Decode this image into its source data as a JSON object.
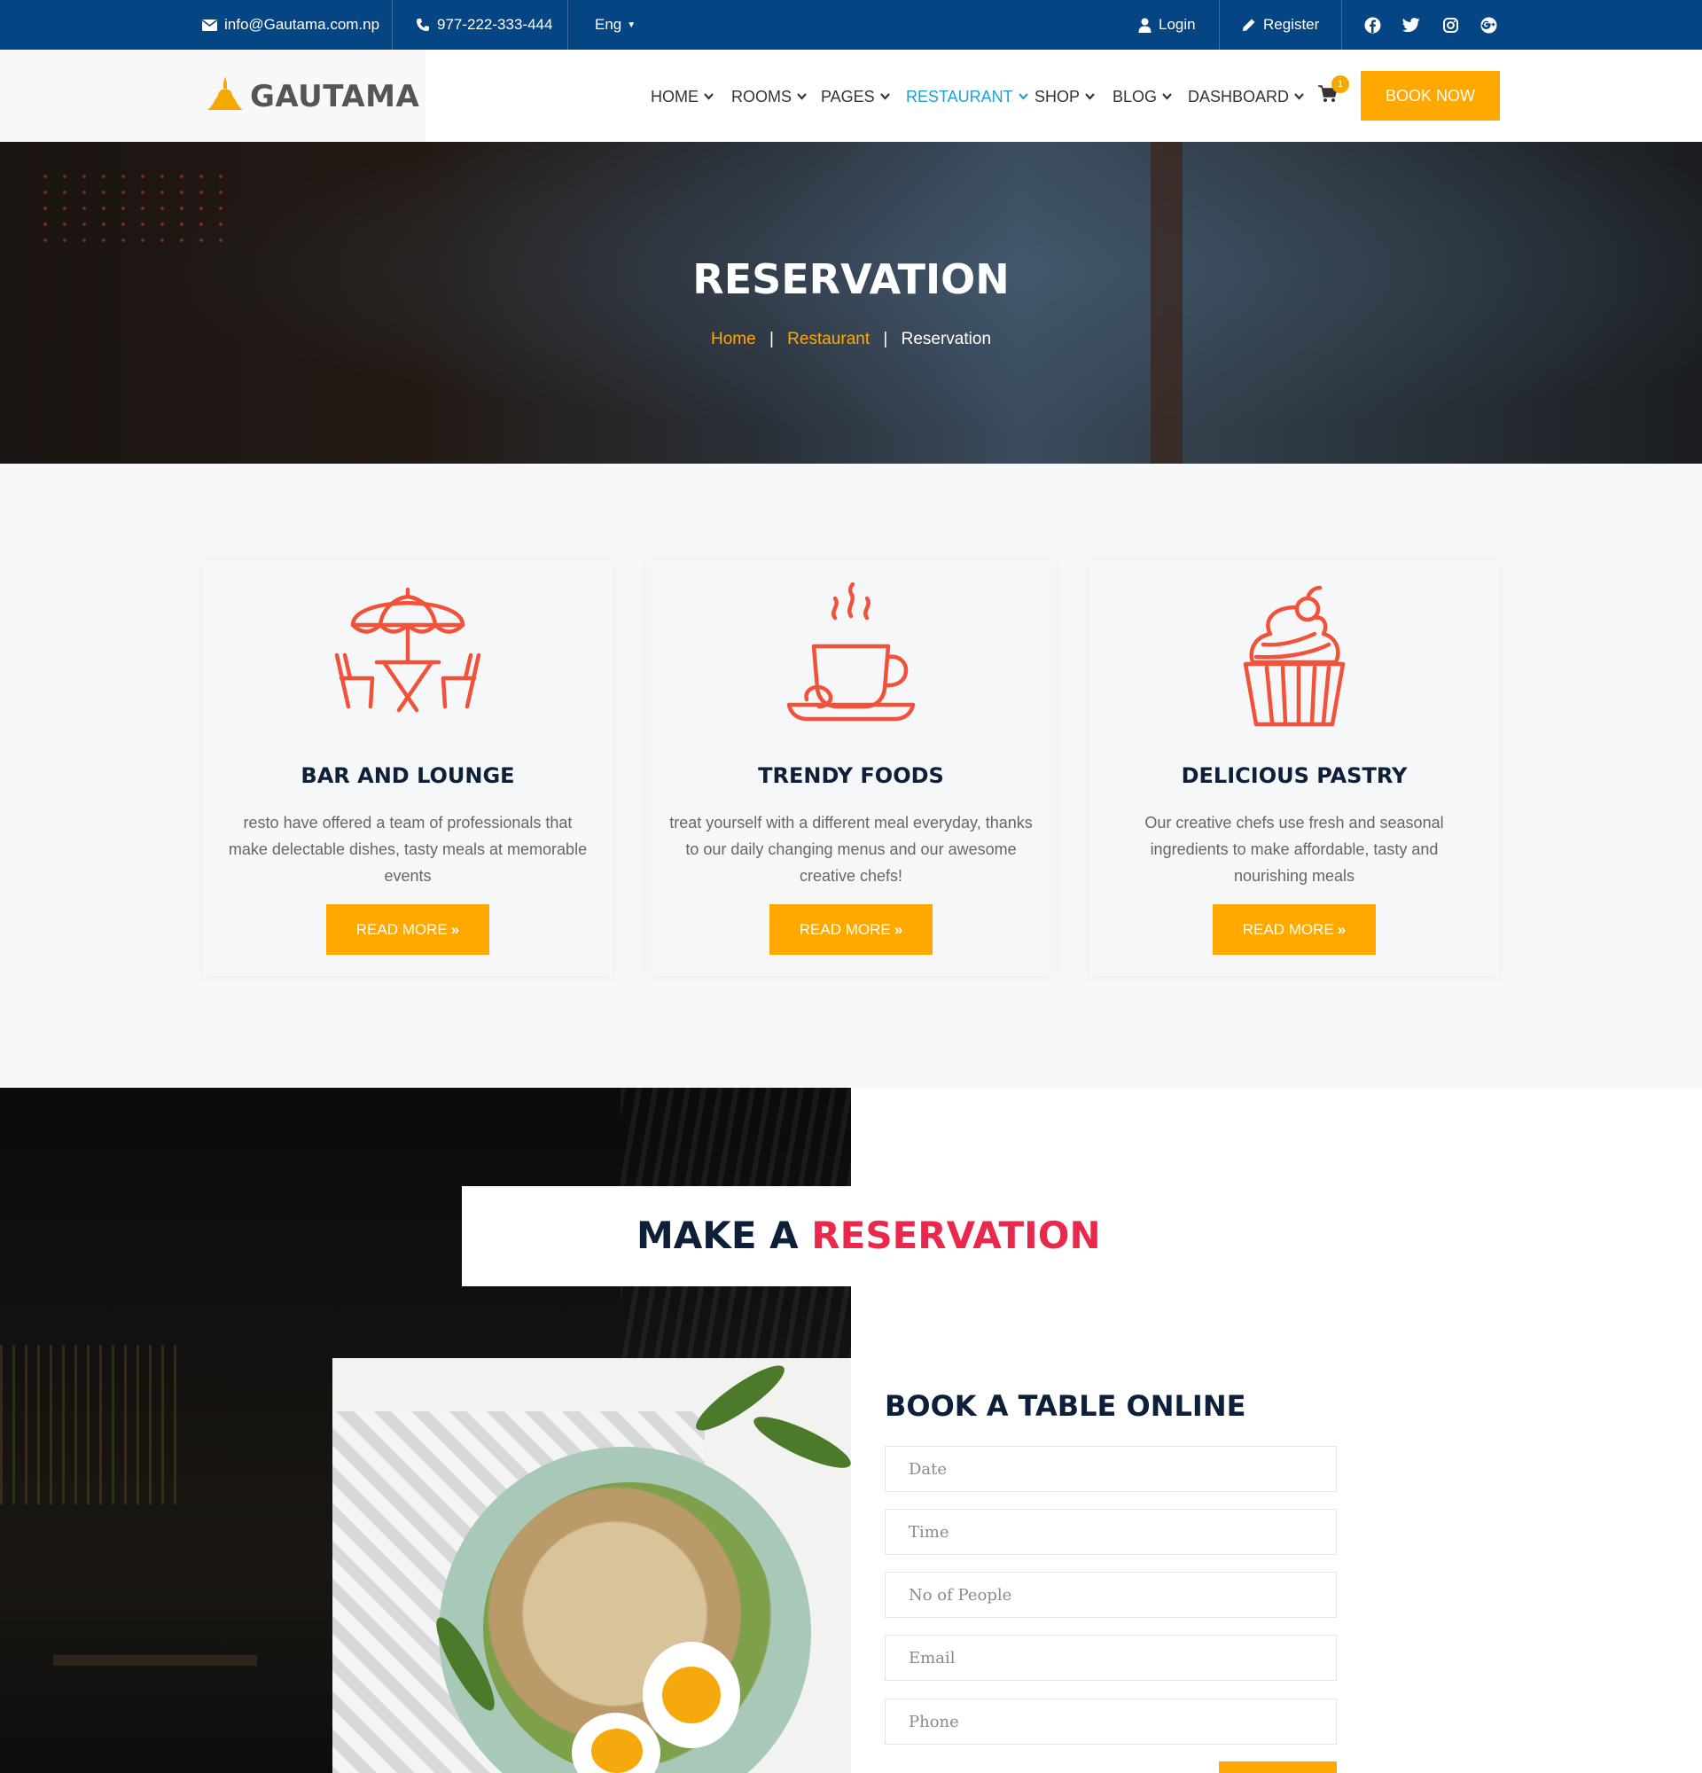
{
  "topbar": {
    "email": "info@Gautama.com.np",
    "phone": "977-222-333-444",
    "language": "Eng",
    "login": "Login",
    "register": "Register",
    "social": [
      "facebook-icon",
      "twitter-icon",
      "instagram-icon",
      "google-plus-icon"
    ]
  },
  "header": {
    "logo": "GAUTAMA",
    "nav": [
      "HOME",
      "ROOMS",
      "PAGES",
      "RESTAURANT",
      "SHOP",
      "BLOG",
      "DASHBOARD"
    ],
    "active_nav": "RESTAURANT",
    "cart_count": "1",
    "book_now": "BOOK NOW"
  },
  "hero": {
    "title": "RESERVATION",
    "breadcrumb": [
      "Home",
      "Restaurant",
      "Reservation"
    ]
  },
  "features": [
    {
      "icon": "patio-table-icon",
      "title": "BAR AND LOUNGE",
      "desc": "resto have offered a team of professionals that make delectable dishes, tasty meals at memorable events",
      "button": "READ MORE"
    },
    {
      "icon": "coffee-cup-icon",
      "title": "TRENDY FOODS",
      "desc": "treat yourself with a different meal everyday, thanks to our daily changing menus and our awesome creative chefs!",
      "button": "READ MORE"
    },
    {
      "icon": "cupcake-icon",
      "title": "DELICIOUS PASTRY",
      "desc": "Our creative chefs use fresh and seasonal ingredients to make affordable, tasty and nourishing meals",
      "button": "READ MORE"
    }
  ],
  "reservation": {
    "title_prefix": "MAKE A",
    "title_accent": "RESERVATION",
    "form_title": "BOOK A TABLE ONLINE",
    "fields": [
      "Date",
      "Time",
      "No of People",
      "Email",
      "Phone"
    ]
  },
  "colors": {
    "topbar": "#054584",
    "accent": "#ffa800",
    "nav_active": "#1ea0d8",
    "heading": "#0e1f3a",
    "highlight": "#e8294c",
    "icon": "#f2523a"
  }
}
